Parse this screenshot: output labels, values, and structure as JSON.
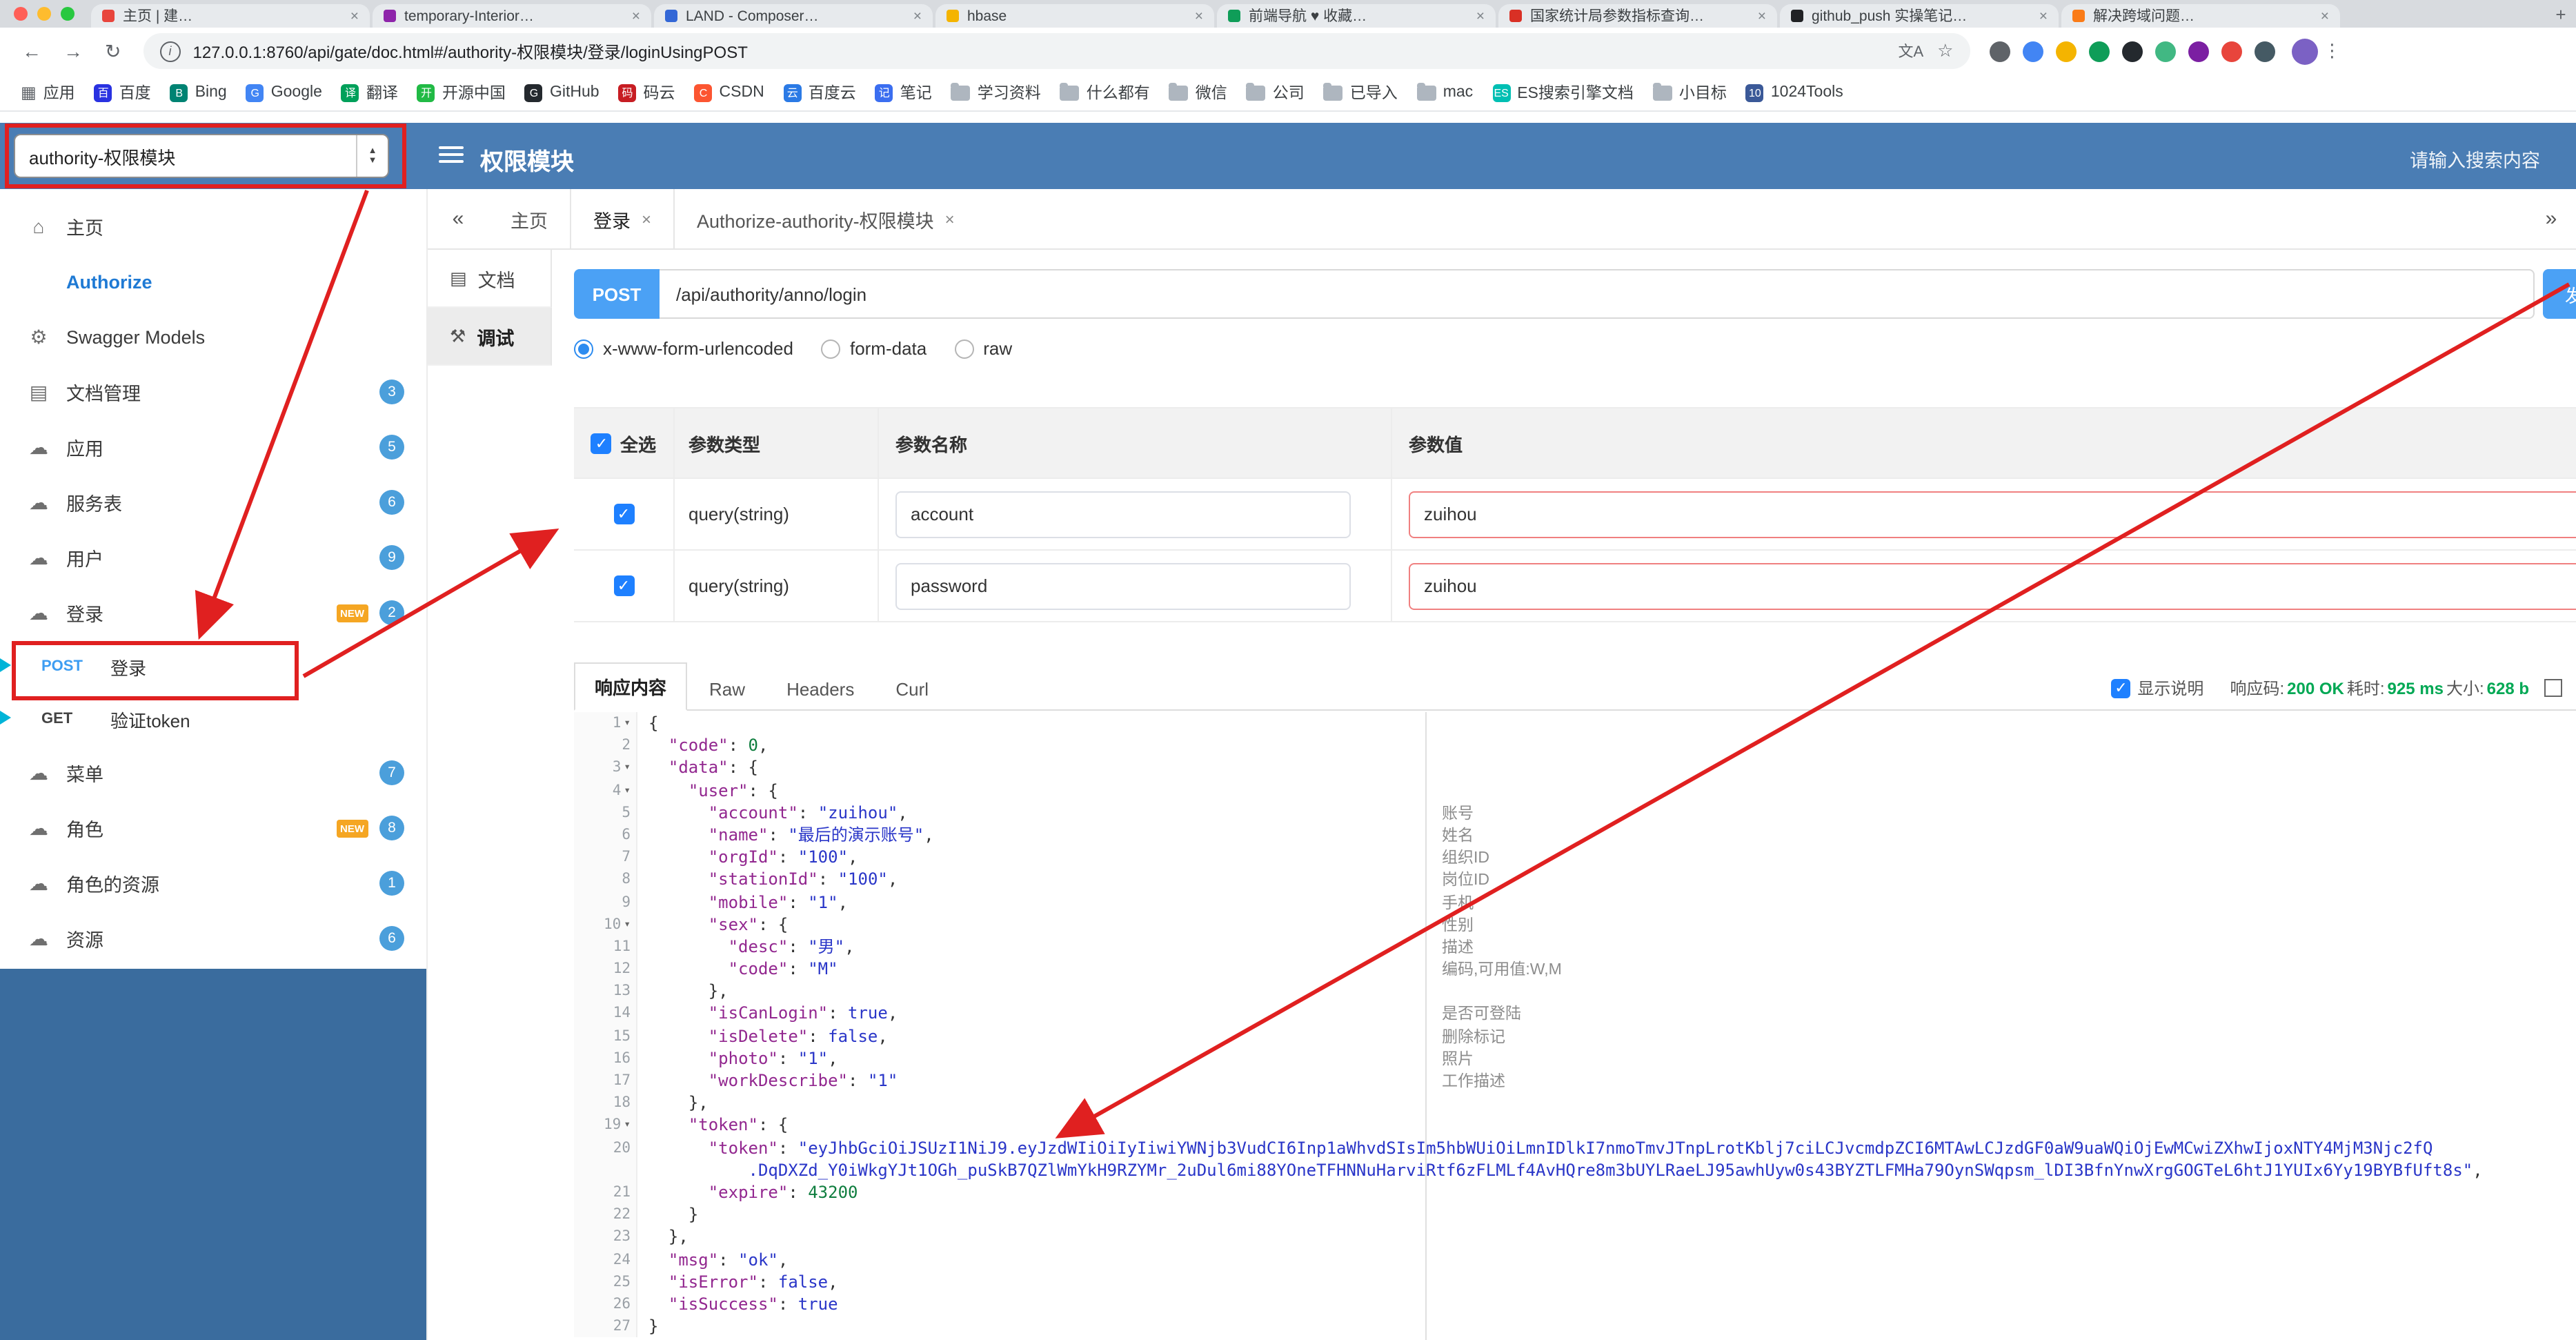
{
  "icons": {
    "back": "←",
    "forward": "→",
    "reload": "↻",
    "info": "i",
    "translate": "文A",
    "star": "☆",
    "menu": "⋮",
    "close": "×",
    "collapse": "«",
    "expand": "»",
    "fold": "▾",
    "home": "⌂",
    "gear": "⚙",
    "doc": "▤",
    "cloud": "☁",
    "debug": "⚒",
    "grid": "▦",
    "newtab": "+"
  },
  "browser": {
    "tabs": [
      {
        "title": "主页 | 建…",
        "color": "#e8453c"
      },
      {
        "title": "temporary-Interior…",
        "color": "#8e24aa"
      },
      {
        "title": "LAND - Composer…",
        "color": "#3367d6"
      },
      {
        "title": "hbase",
        "color": "#f4b400"
      },
      {
        "title": "前端导航 ♥ 收藏…",
        "color": "#0f9d58"
      },
      {
        "title": "国家统计局参数指标查询…",
        "color": "#d93025"
      },
      {
        "title": "github_push 实操笔记…",
        "color": "#202124"
      },
      {
        "title": "解决跨域问题…",
        "color": "#fa7b17"
      }
    ],
    "url": "127.0.0.1:8760/api/gate/doc.html#/authority-权限模块/登录/loginUsingPOST",
    "extensions": [
      {
        "name": "screenshot-extension-icon",
        "color": "#5f6368"
      },
      {
        "name": "chrome-icon",
        "color": "#4285f4"
      },
      {
        "name": "json-viewer-extension-icon",
        "color": "#f4b400"
      },
      {
        "name": "translate-extension-icon",
        "color": "#0f9d58"
      },
      {
        "name": "octotree-extension-icon",
        "color": "#24292e"
      },
      {
        "name": "vue-devtools-extension-icon",
        "color": "#41b883"
      },
      {
        "name": "proxy-extension-icon",
        "color": "#7b1fa2"
      },
      {
        "name": "notes-extension-icon",
        "color": "#e8453c"
      },
      {
        "name": "dark-reader-extension-icon",
        "color": "#455a64"
      }
    ],
    "bookmarks": [
      {
        "label": "应用",
        "icon": "grid"
      },
      {
        "label": "百度",
        "icon": "letter",
        "ch": "百",
        "bg": "#2932e1"
      },
      {
        "label": "Bing",
        "icon": "letter",
        "ch": "B",
        "bg": "#008373"
      },
      {
        "label": "Google",
        "icon": "letter",
        "ch": "G",
        "bg": "#4285f4"
      },
      {
        "label": "翻译",
        "icon": "letter",
        "ch": "译",
        "bg": "#00a05a"
      },
      {
        "label": "开源中国",
        "icon": "letter",
        "ch": "开",
        "bg": "#21ba45"
      },
      {
        "label": "GitHub",
        "icon": "letter",
        "ch": "G",
        "bg": "#24292e"
      },
      {
        "label": "码云",
        "icon": "letter",
        "ch": "码",
        "bg": "#c71d23"
      },
      {
        "label": "CSDN",
        "icon": "letter",
        "ch": "C",
        "bg": "#fc5531"
      },
      {
        "label": "百度云",
        "icon": "letter",
        "ch": "云",
        "bg": "#2b7ae5"
      },
      {
        "label": "笔记",
        "icon": "letter",
        "ch": "记",
        "bg": "#3b6ef0"
      },
      {
        "label": "学习资料",
        "icon": "folder"
      },
      {
        "label": "什么都有",
        "icon": "folder"
      },
      {
        "label": "微信",
        "icon": "folder"
      },
      {
        "label": "公司",
        "icon": "folder"
      },
      {
        "label": "已导入",
        "icon": "folder"
      },
      {
        "label": "mac",
        "icon": "folder"
      },
      {
        "label": "ES搜索引擎文档",
        "icon": "letter",
        "ch": "ES",
        "bg": "#00bfb3"
      },
      {
        "label": "小目标",
        "icon": "folder"
      },
      {
        "label": "1024Tools",
        "icon": "letter",
        "ch": "10",
        "bg": "#3b5998"
      }
    ]
  },
  "header": {
    "module_select": "authority-权限模块",
    "title": "权限模块",
    "search_placeholder": "请输入搜索内容"
  },
  "sidebar": {
    "new_label": "NEW",
    "items": [
      {
        "label": "主页",
        "icon": "home"
      },
      {
        "label": "Authorize",
        "icon": "lock",
        "accent": true
      },
      {
        "label": "Swagger Models",
        "icon": "gear"
      },
      {
        "label": "文档管理",
        "icon": "doc",
        "badge": "3"
      },
      {
        "label": "应用",
        "icon": "cloud",
        "badge": "5"
      },
      {
        "label": "服务表",
        "icon": "cloud",
        "badge": "6"
      },
      {
        "label": "用户",
        "icon": "cloud",
        "badge": "9"
      },
      {
        "label": "登录",
        "icon": "cloud",
        "badge": "2",
        "new": true
      },
      {
        "method": "POST",
        "label": "登录",
        "flag": true,
        "selected": true
      },
      {
        "method": "GET",
        "label": "验证token",
        "flag": true
      },
      {
        "label": "菜单",
        "icon": "cloud",
        "badge": "7"
      },
      {
        "label": "角色",
        "icon": "cloud",
        "badge": "8",
        "new": true
      },
      {
        "label": "角色的资源",
        "icon": "cloud",
        "badge": "1"
      },
      {
        "label": "资源",
        "icon": "cloud",
        "badge": "6"
      }
    ]
  },
  "doc_tabs": {
    "tabs": [
      {
        "label": "主页",
        "closable": false,
        "active": false
      },
      {
        "label": "登录",
        "closable": true,
        "active": true
      },
      {
        "label": "Authorize-authority-权限模块",
        "closable": true,
        "active": false
      }
    ]
  },
  "panel": {
    "doc_label": "文档",
    "debug_label": "调试"
  },
  "endpoint": {
    "method": "POST",
    "path": "/api/authority/anno/login",
    "send_label": "发送"
  },
  "content_types": {
    "options": [
      "x-www-form-urlencoded",
      "form-data",
      "raw"
    ],
    "selected": 0
  },
  "param_table": {
    "select_all": "全选",
    "headers": [
      "参数类型",
      "参数名称",
      "参数值"
    ],
    "rows": [
      {
        "checked": true,
        "type": "query(string)",
        "name": "account",
        "value": "zuihou",
        "required": true
      },
      {
        "checked": true,
        "type": "query(string)",
        "name": "password",
        "value": "zuihou",
        "required": true
      }
    ]
  },
  "response": {
    "tabs": [
      "响应内容",
      "Raw",
      "Headers",
      "Curl"
    ],
    "active": 0,
    "show_desc": "显示说明",
    "meta": [
      {
        "label": "响应码:",
        "value": "200 OK"
      },
      {
        "label": "耗时:",
        "value": "925 ms"
      },
      {
        "label": "大小:",
        "value": "628 b"
      }
    ]
  },
  "editor": {
    "rows": [
      [
        1,
        1,
        [
          [
            "p",
            "{"
          ]
        ],
        null
      ],
      [
        2,
        0,
        [
          [
            "w",
            "  "
          ],
          [
            "k",
            "\"code\""
          ],
          [
            "p",
            ": "
          ],
          [
            "n",
            "0"
          ],
          [
            "p",
            ","
          ]
        ],
        null
      ],
      [
        3,
        1,
        [
          [
            "w",
            "  "
          ],
          [
            "k",
            "\"data\""
          ],
          [
            "p",
            ": {"
          ]
        ],
        null
      ],
      [
        4,
        1,
        [
          [
            "w",
            "    "
          ],
          [
            "k",
            "\"user\""
          ],
          [
            "p",
            ": {"
          ]
        ],
        null
      ],
      [
        5,
        0,
        [
          [
            "w",
            "      "
          ],
          [
            "k",
            "\"account\""
          ],
          [
            "p",
            ": "
          ],
          [
            "s",
            "\"zuihou\""
          ],
          [
            "p",
            ","
          ]
        ],
        "账号"
      ],
      [
        6,
        0,
        [
          [
            "w",
            "      "
          ],
          [
            "k",
            "\"name\""
          ],
          [
            "p",
            ": "
          ],
          [
            "s",
            "\"最后的演示账号\""
          ],
          [
            "p",
            ","
          ]
        ],
        "姓名"
      ],
      [
        7,
        0,
        [
          [
            "w",
            "      "
          ],
          [
            "k",
            "\"orgId\""
          ],
          [
            "p",
            ": "
          ],
          [
            "s",
            "\"100\""
          ],
          [
            "p",
            ","
          ]
        ],
        "组织ID"
      ],
      [
        8,
        0,
        [
          [
            "w",
            "      "
          ],
          [
            "k",
            "\"stationId\""
          ],
          [
            "p",
            ": "
          ],
          [
            "s",
            "\"100\""
          ],
          [
            "p",
            ","
          ]
        ],
        "岗位ID"
      ],
      [
        9,
        0,
        [
          [
            "w",
            "      "
          ],
          [
            "k",
            "\"mobile\""
          ],
          [
            "p",
            ": "
          ],
          [
            "s",
            "\"1\""
          ],
          [
            "p",
            ","
          ]
        ],
        "手机"
      ],
      [
        10,
        1,
        [
          [
            "w",
            "      "
          ],
          [
            "k",
            "\"sex\""
          ],
          [
            "p",
            ": {"
          ]
        ],
        "性别"
      ],
      [
        11,
        0,
        [
          [
            "w",
            "        "
          ],
          [
            "k",
            "\"desc\""
          ],
          [
            "p",
            ": "
          ],
          [
            "s",
            "\"男\""
          ],
          [
            "p",
            ","
          ]
        ],
        "描述"
      ],
      [
        12,
        0,
        [
          [
            "w",
            "        "
          ],
          [
            "k",
            "\"code\""
          ],
          [
            "p",
            ": "
          ],
          [
            "s",
            "\"M\""
          ]
        ],
        "编码,可用值:W,M"
      ],
      [
        13,
        0,
        [
          [
            "w",
            "      "
          ],
          [
            "p",
            "},"
          ]
        ],
        null
      ],
      [
        14,
        0,
        [
          [
            "w",
            "      "
          ],
          [
            "k",
            "\"isCanLogin\""
          ],
          [
            "p",
            ": "
          ],
          [
            "b",
            "true"
          ],
          [
            "p",
            ","
          ]
        ],
        "是否可登陆"
      ],
      [
        15,
        0,
        [
          [
            "w",
            "      "
          ],
          [
            "k",
            "\"isDelete\""
          ],
          [
            "p",
            ": "
          ],
          [
            "b",
            "false"
          ],
          [
            "p",
            ","
          ]
        ],
        "删除标记"
      ],
      [
        16,
        0,
        [
          [
            "w",
            "      "
          ],
          [
            "k",
            "\"photo\""
          ],
          [
            "p",
            ": "
          ],
          [
            "s",
            "\"1\""
          ],
          [
            "p",
            ","
          ]
        ],
        "照片"
      ],
      [
        17,
        0,
        [
          [
            "w",
            "      "
          ],
          [
            "k",
            "\"workDescribe\""
          ],
          [
            "p",
            ": "
          ],
          [
            "s",
            "\"1\""
          ]
        ],
        "工作描述"
      ],
      [
        18,
        0,
        [
          [
            "w",
            "    "
          ],
          [
            "p",
            "},"
          ]
        ],
        null
      ],
      [
        19,
        1,
        [
          [
            "w",
            "    "
          ],
          [
            "k",
            "\"token\""
          ],
          [
            "p",
            ": {"
          ]
        ],
        null
      ],
      [
        20,
        0,
        [
          [
            "w",
            "      "
          ],
          [
            "k",
            "\"token\""
          ],
          [
            "p",
            ": "
          ],
          [
            "s",
            "\"eyJhbGciOiJSUzI1NiJ9.eyJzdWIiOiIyIiwiYWNjb3VudCI6Inp1aWhvdSIsIm5hbWUiOiLmnIDlkI7nmoTmvJTnpLrotKblj7ciLCJvcmdpZCI6MTAwLCJzdGF0aW9uaWQiOjEwMCwiZXhwIjoxNTY4MjM3Njc2fQ"
          ]
        ],
        null
      ],
      [
        null,
        0,
        [
          [
            "w",
            "          "
          ],
          [
            "s",
            ".DqDXZd_Y0iWkgYJt1OGh_puSkB7QZlWmYkH9RZYMr_2uDul6mi88YOneTFHNNuHarviRtf6zFLMLf4AvHQre8m3bUYLRaeLJ95awhUyw0s43BYZTLFMHa79OynSWqpsm_lDI3BfnYnwXrgGOGTeL6htJ1YUIx6Yy19BYBfUft8s\""
          ],
          [
            "p",
            ","
          ]
        ],
        null
      ],
      [
        21,
        0,
        [
          [
            "w",
            "      "
          ],
          [
            "k",
            "\"expire\""
          ],
          [
            "p",
            ": "
          ],
          [
            "n",
            "43200"
          ]
        ],
        null
      ],
      [
        22,
        0,
        [
          [
            "w",
            "    "
          ],
          [
            "p",
            "}"
          ]
        ],
        null
      ],
      [
        23,
        0,
        [
          [
            "w",
            "  "
          ],
          [
            "p",
            "},"
          ]
        ],
        null
      ],
      [
        24,
        0,
        [
          [
            "w",
            "  "
          ],
          [
            "k",
            "\"msg\""
          ],
          [
            "p",
            ": "
          ],
          [
            "s",
            "\"ok\""
          ],
          [
            "p",
            ","
          ]
        ],
        null
      ],
      [
        25,
        0,
        [
          [
            "w",
            "  "
          ],
          [
            "k",
            "\"isError\""
          ],
          [
            "p",
            ": "
          ],
          [
            "b",
            "false"
          ],
          [
            "p",
            ","
          ]
        ],
        null
      ],
      [
        26,
        0,
        [
          [
            "w",
            "  "
          ],
          [
            "k",
            "\"isSuccess\""
          ],
          [
            "p",
            ": "
          ],
          [
            "b",
            "true"
          ]
        ],
        null
      ],
      [
        27,
        0,
        [
          [
            "p",
            "}"
          ]
        ],
        null
      ]
    ]
  }
}
